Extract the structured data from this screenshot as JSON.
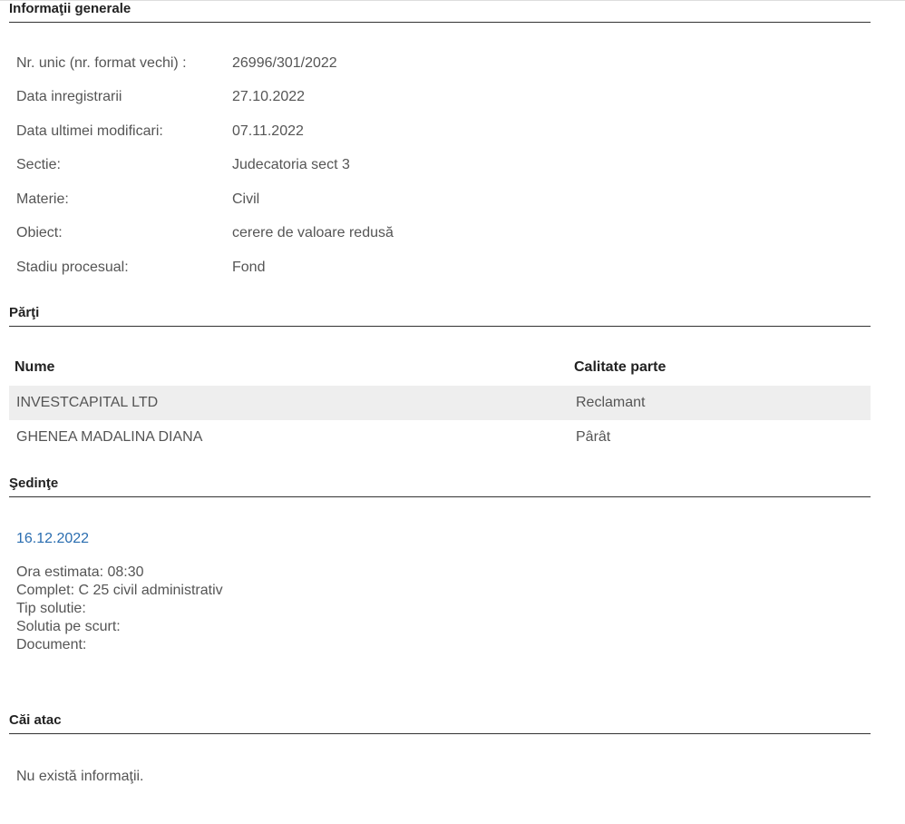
{
  "general": {
    "title": "Informaţii generale",
    "rows": [
      {
        "label": "Nr. unic (nr. format vechi) :",
        "value": "26996/301/2022"
      },
      {
        "label": "Data inregistrarii",
        "value": "27.10.2022"
      },
      {
        "label": "Data ultimei modificari:",
        "value": "07.11.2022"
      },
      {
        "label": "Sectie:",
        "value": "Judecatoria sect 3"
      },
      {
        "label": "Materie:",
        "value": "Civil"
      },
      {
        "label": "Obiect:",
        "value": "cerere de valoare redusă"
      },
      {
        "label": "Stadiu procesual:",
        "value": "Fond"
      }
    ]
  },
  "parties": {
    "title": "Părţi",
    "columns": {
      "name": "Nume",
      "role": "Calitate parte"
    },
    "rows": [
      {
        "name": "INVESTCAPITAL LTD",
        "role": "Reclamant"
      },
      {
        "name": "GHENEA MADALINA DIANA",
        "role": "Pârât"
      }
    ]
  },
  "hearings": {
    "title": "Şedinţe",
    "date": "16.12.2022",
    "details": [
      "Ora estimata: 08:30",
      "Complet: C 25 civil administrativ",
      "Tip solutie:",
      "Solutia pe scurt:",
      "Document:"
    ]
  },
  "appeals": {
    "title": "Căi atac",
    "empty_text": "Nu există informaţii."
  },
  "colors": {
    "link": "#2a6db0",
    "row_shade": "#eeeeee",
    "rule": "#333333"
  }
}
